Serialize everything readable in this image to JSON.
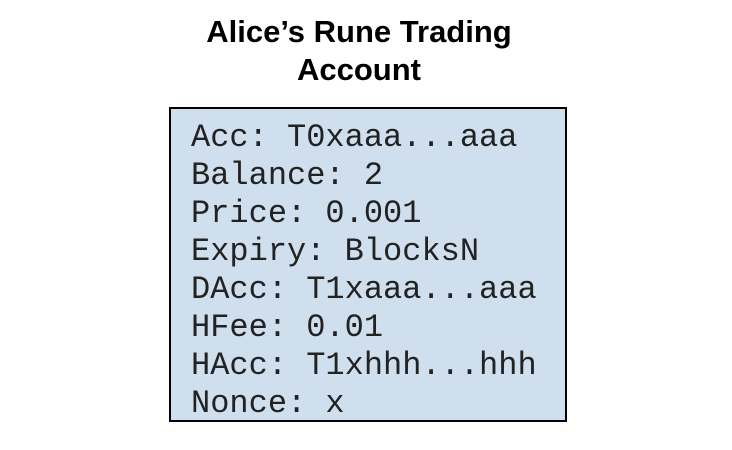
{
  "title": {
    "line1": "Alice’s Rune Trading",
    "line2": "Account"
  },
  "account_box": {
    "fields": [
      "Acc: T0xaaa...aaa",
      "Balance: 2",
      "Price: 0.001",
      "Expiry: BlocksN",
      "DAcc: T1xaaa...aaa",
      "HFee: 0.01",
      "HAcc: T1xhhh...hhh",
      "Nonce: x"
    ],
    "background_color": "#cfdfee",
    "border_color": "#000000"
  }
}
